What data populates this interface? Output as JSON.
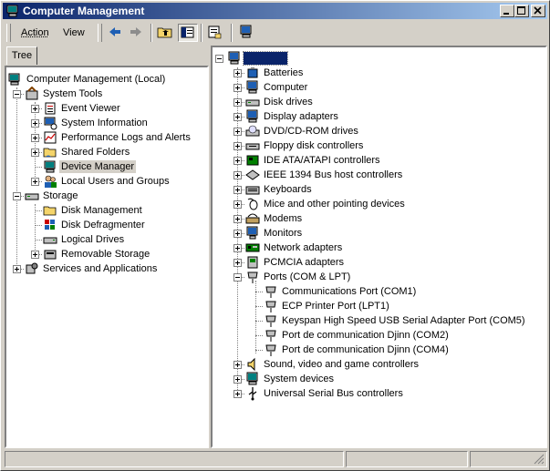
{
  "window": {
    "title": "Computer Management"
  },
  "menu": {
    "action": "Action",
    "view": "View"
  },
  "tabs": {
    "tree": "Tree"
  },
  "left_tree": [
    {
      "key": "root",
      "label": "Computer Management (Local)",
      "icon": "computer-management-icon"
    },
    {
      "key": "system_tools",
      "label": "System Tools",
      "icon": "system-tools-icon"
    },
    {
      "key": "event_viewer",
      "label": "Event Viewer",
      "icon": "event-viewer-icon"
    },
    {
      "key": "system_information",
      "label": "System Information",
      "icon": "system-information-icon"
    },
    {
      "key": "performance_logs",
      "label": "Performance Logs and Alerts",
      "icon": "performance-logs-icon"
    },
    {
      "key": "shared_folders",
      "label": "Shared Folders",
      "icon": "shared-folders-icon"
    },
    {
      "key": "device_manager",
      "label": "Device Manager",
      "icon": "device-manager-icon",
      "selected": true
    },
    {
      "key": "local_users",
      "label": "Local Users and Groups",
      "icon": "local-users-icon"
    },
    {
      "key": "storage",
      "label": "Storage",
      "icon": "storage-icon"
    },
    {
      "key": "disk_management",
      "label": "Disk Management",
      "icon": "disk-management-icon"
    },
    {
      "key": "disk_defragmenter",
      "label": "Disk Defragmenter",
      "icon": "disk-defragmenter-icon"
    },
    {
      "key": "logical_drives",
      "label": "Logical Drives",
      "icon": "logical-drives-icon"
    },
    {
      "key": "removable_storage",
      "label": "Removable Storage",
      "icon": "removable-storage-icon"
    },
    {
      "key": "services_apps",
      "label": "Services and Applications",
      "icon": "services-applications-icon"
    }
  ],
  "device_tree": [
    {
      "key": "computer_root",
      "label": "",
      "icon": "computer-icon",
      "focused": true
    },
    {
      "key": "batteries",
      "label": "Batteries",
      "icon": "battery-icon"
    },
    {
      "key": "computer",
      "label": "Computer",
      "icon": "computer-icon"
    },
    {
      "key": "disk_drives",
      "label": "Disk drives",
      "icon": "disk-drive-icon"
    },
    {
      "key": "display_adapters",
      "label": "Display adapters",
      "icon": "display-adapter-icon"
    },
    {
      "key": "dvd_cdrom",
      "label": "DVD/CD-ROM drives",
      "icon": "cdrom-icon"
    },
    {
      "key": "floppy",
      "label": "Floppy disk controllers",
      "icon": "floppy-controller-icon"
    },
    {
      "key": "ide",
      "label": "IDE ATA/ATAPI controllers",
      "icon": "ide-controller-icon"
    },
    {
      "key": "ieee1394",
      "label": "IEEE 1394 Bus host controllers",
      "icon": "ieee1394-icon"
    },
    {
      "key": "keyboards",
      "label": "Keyboards",
      "icon": "keyboard-icon"
    },
    {
      "key": "mice",
      "label": "Mice and other pointing devices",
      "icon": "mouse-icon"
    },
    {
      "key": "modems",
      "label": "Modems",
      "icon": "modem-icon"
    },
    {
      "key": "monitors",
      "label": "Monitors",
      "icon": "monitor-icon"
    },
    {
      "key": "network",
      "label": "Network adapters",
      "icon": "network-adapter-icon"
    },
    {
      "key": "pcmcia",
      "label": "PCMCIA adapters",
      "icon": "pcmcia-icon"
    },
    {
      "key": "ports",
      "label": "Ports (COM & LPT)",
      "icon": "port-icon"
    },
    {
      "key": "com1",
      "label": "Communications Port (COM1)",
      "icon": "port-icon"
    },
    {
      "key": "lpt1",
      "label": "ECP Printer Port (LPT1)",
      "icon": "port-icon"
    },
    {
      "key": "keyspan",
      "label": "Keyspan High Speed USB Serial Adapter Port (COM5)",
      "icon": "port-icon"
    },
    {
      "key": "djinn_com2",
      "label": "Port de communication Djinn (COM2)",
      "icon": "port-icon"
    },
    {
      "key": "djinn_com4",
      "label": "Port de communication Djinn (COM4)",
      "icon": "port-icon"
    },
    {
      "key": "sound",
      "label": "Sound, video and game controllers",
      "icon": "sound-icon"
    },
    {
      "key": "system_devices",
      "label": "System devices",
      "icon": "system-devices-icon"
    },
    {
      "key": "usb",
      "label": "Universal Serial Bus controllers",
      "icon": "usb-icon"
    }
  ]
}
